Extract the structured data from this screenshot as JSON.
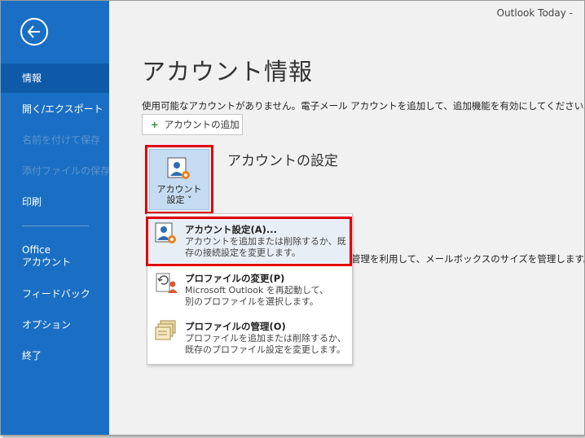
{
  "window": {
    "title": "Outlook Today  -"
  },
  "sidebar": {
    "items": [
      {
        "label": "情報"
      },
      {
        "label": "開く/エクスポート"
      },
      {
        "label": "名前を付けて保存"
      },
      {
        "label": "添付ファイルの保存"
      },
      {
        "label": "印刷"
      },
      {
        "label_line1": "Office",
        "label_line2": "アカウント"
      },
      {
        "label": "フィードバック"
      },
      {
        "label": "オプション"
      },
      {
        "label": "終了"
      }
    ]
  },
  "main": {
    "title": "アカウント情報",
    "description": "使用可能なアカウントがありません。電子メール アカウントを追加して、追加機能を有効にしてください。",
    "add_account_label": "アカウントの追加",
    "account_settings_button": {
      "line1": "アカウント",
      "line2": "設定 ˅"
    },
    "account_settings_heading": "アカウントの設定",
    "background_text": "管理を利用して、メールボックスのサイズを管理します。"
  },
  "dropdown": {
    "items": [
      {
        "title": "アカウント設定(A)...",
        "desc_line1": "アカウントを追加または削除するか、既",
        "desc_line2": "存の接続設定を変更します。"
      },
      {
        "title": "プロファイルの変更(P)",
        "desc_line1": "Microsoft Outlook を再起動して、",
        "desc_line2": "別のプロファイルを選択します。"
      },
      {
        "title": "プロファイルの管理(O)",
        "desc_line1": "プロファイルを追加または削除するか、",
        "desc_line2": "既存のプロファイル設定を変更します。"
      }
    ]
  },
  "colors": {
    "sidebar_bg": "#1a6fc4",
    "sidebar_selected": "#0f5aa8",
    "highlight_border": "#e00000",
    "content_bg": "#f1f1f1"
  },
  "icons": [
    "back-arrow-icon",
    "plus-icon",
    "account-settings-icon",
    "profile-change-icon",
    "profile-manage-icon"
  ]
}
